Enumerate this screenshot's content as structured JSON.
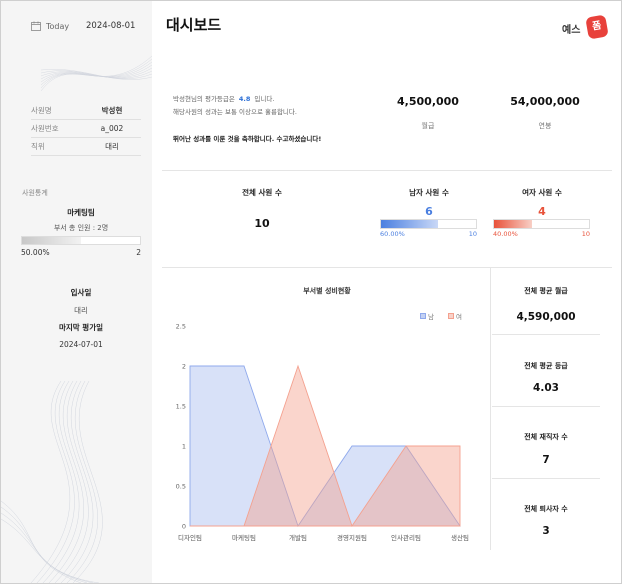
{
  "sidebar": {
    "today_label": "Today",
    "today_date": "2024-08-01",
    "employee": [
      {
        "key": "사원명",
        "value": "박성현",
        "bold": true
      },
      {
        "key": "사원번호",
        "value": "a_002",
        "bold": false
      },
      {
        "key": "직위",
        "value": "대리",
        "bold": false
      }
    ],
    "stats_title": "사원통계",
    "dept": "마케팅팀",
    "dept_people": "부서 총 인원 : 2명",
    "dept_pct": "50.00%",
    "dept_pct_value": 0.5,
    "dept_max": "2",
    "join_label": "입사일",
    "join_position": "대리",
    "last_eval_label": "마지막 평가일",
    "last_eval_date": "2024-07-01"
  },
  "header": {
    "title": "대시보드",
    "logo_text": "예스",
    "logo_badge": "폼"
  },
  "message": {
    "line1_prefix": "박성현님의 평가등급은",
    "grade": "4.8",
    "line1_suffix": "입니다.",
    "line2": "해당사원의 성과는 보통 이상으로 훌륭합니다.",
    "line3": "뛰어난 성과를 이룬 것을 축하합니다. 수고하셨습니다!"
  },
  "salary": {
    "monthly_value": "4,500,000",
    "monthly_label": "월급",
    "annual_value": "54,000,000",
    "annual_label": "연봉"
  },
  "staff": {
    "total_label": "전체 사원 수",
    "total_value": "10",
    "male_label": "남자 사원 수",
    "male_value": "6",
    "male_pct": "60.00%",
    "male_ratio": 0.6,
    "male_max": "10",
    "female_label": "여자 사원 수",
    "female_value": "4",
    "female_pct": "40.00%",
    "female_ratio": 0.4,
    "female_max": "10",
    "male_color": "#4a7fe0",
    "female_color": "#e8523a"
  },
  "summary": [
    {
      "label": "전체 평균 월급",
      "value": "4,590,000"
    },
    {
      "label": "전체 평균 등급",
      "value": "4.03"
    },
    {
      "label": "전체 재직자 수",
      "value": "7"
    },
    {
      "label": "전체 퇴사자 수",
      "value": "3"
    }
  ],
  "chart_data": {
    "type": "area",
    "title": "부서별 성비현황",
    "categories": [
      "디자인팀",
      "마케팅팀",
      "개발팀",
      "경영지원팀",
      "인사관리팀",
      "생산팀"
    ],
    "series": [
      {
        "name": "남",
        "values": [
          2,
          2,
          0,
          1,
          1,
          0
        ],
        "color": "#8fa9ec"
      },
      {
        "name": "여",
        "values": [
          0,
          0,
          2,
          0,
          1,
          1
        ],
        "color": "#f4a18f"
      }
    ],
    "ylim": [
      0,
      2.5
    ],
    "yticks": [
      "0",
      "0.5",
      "1",
      "1.5",
      "2",
      "2.5"
    ],
    "legend_position": "top-right"
  }
}
